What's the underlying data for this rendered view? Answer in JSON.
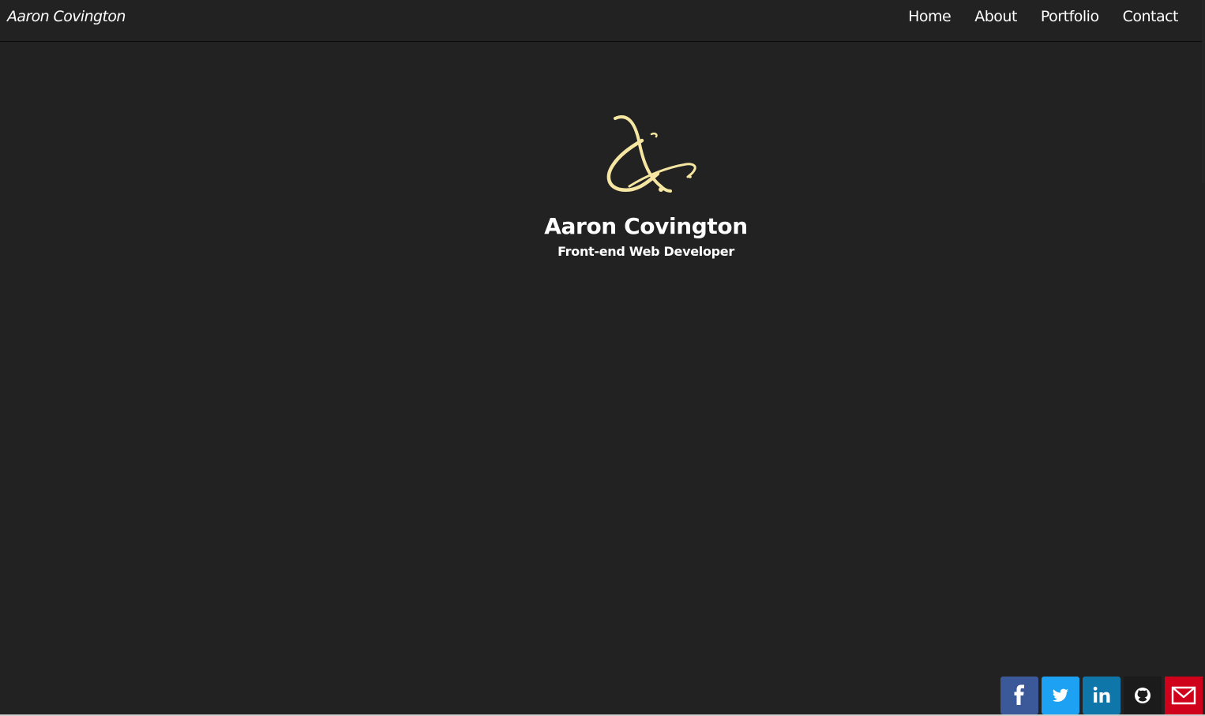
{
  "navbar": {
    "brand": "Aaron Covington",
    "links": [
      "Home",
      "About",
      "Portfolio",
      "Contact"
    ]
  },
  "hero": {
    "logo_icon": "ac-monogram-logo",
    "name": "Aaron Covington",
    "subtitle": "Front-end Web Developer"
  },
  "social": {
    "items": [
      {
        "icon": "facebook-icon",
        "color": "#3b5998"
      },
      {
        "icon": "twitter-icon",
        "color": "#1da1f2"
      },
      {
        "icon": "linkedin-icon",
        "color": "#0e76a8"
      },
      {
        "icon": "github-icon",
        "color": "#1b1b1b"
      },
      {
        "icon": "email-icon",
        "color": "#d0021b"
      }
    ]
  },
  "colors": {
    "background": "#222222",
    "logo_gold": "#f5e6a2",
    "text": "#ffffff"
  }
}
